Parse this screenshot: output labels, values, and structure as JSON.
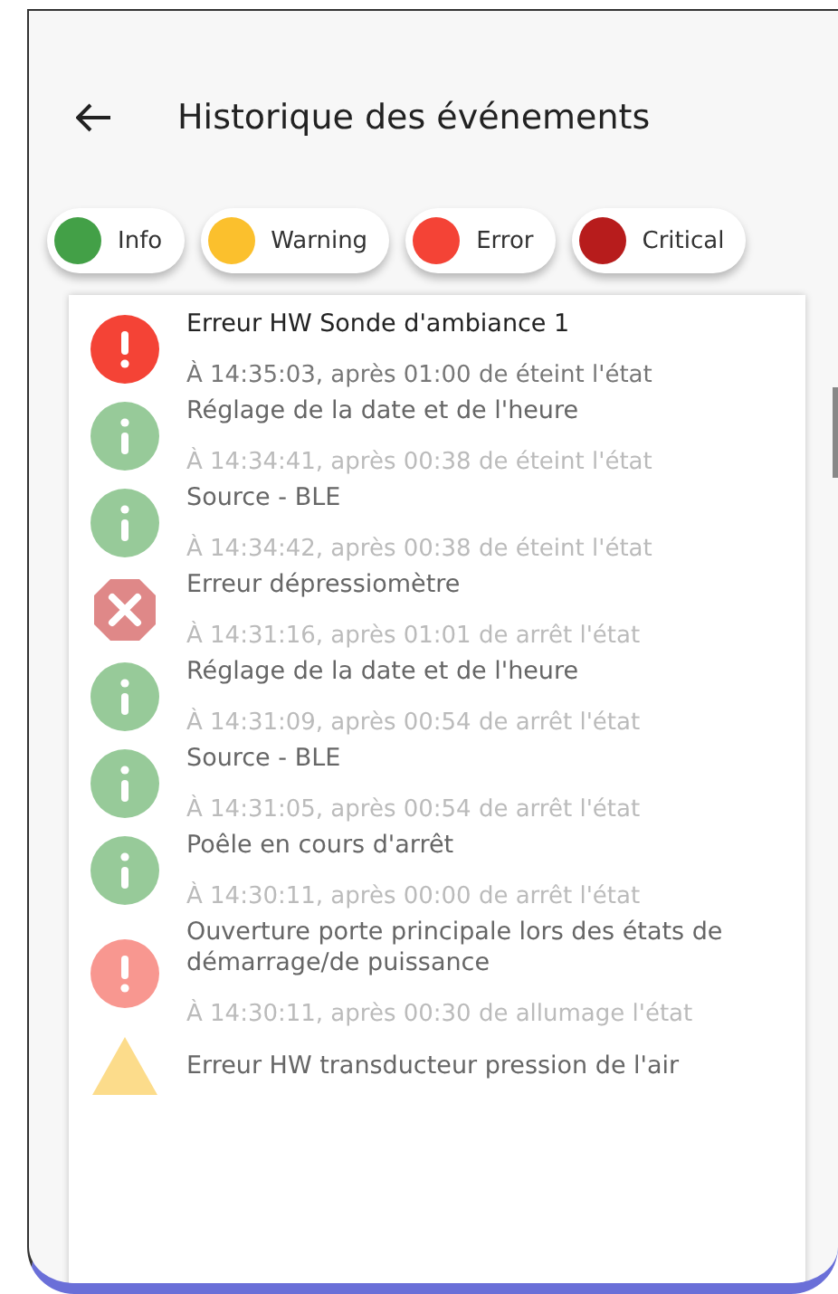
{
  "header": {
    "title": "Historique des événements"
  },
  "filters": [
    {
      "label": "Info",
      "color": "#43a047"
    },
    {
      "label": "Warning",
      "color": "#fbc02d"
    },
    {
      "label": "Error",
      "color": "#f44336"
    },
    {
      "label": "Critical",
      "color": "#b71c1c"
    }
  ],
  "events": [
    {
      "kind": "error",
      "unread": true,
      "title": "Erreur HW Sonde d'ambiance 1",
      "detail": "À 14:35:03, après 01:00 de éteint l'état"
    },
    {
      "kind": "info",
      "unread": false,
      "title": "Réglage de la date et de l'heure",
      "detail": "À 14:34:41, après 00:38 de éteint l'état"
    },
    {
      "kind": "info",
      "unread": false,
      "title": "Source - BLE",
      "detail": "À 14:34:42, après 00:38 de éteint l'état"
    },
    {
      "kind": "critical",
      "unread": false,
      "title": "Erreur dépressiomètre",
      "detail": "À 14:31:16, après 01:01 de arrêt l'état"
    },
    {
      "kind": "info",
      "unread": false,
      "title": "Réglage de la date et de l'heure",
      "detail": "À 14:31:09, après 00:54 de arrêt l'état"
    },
    {
      "kind": "info",
      "unread": false,
      "title": "Source - BLE",
      "detail": "À 14:31:05, après 00:54 de arrêt l'état"
    },
    {
      "kind": "info",
      "unread": false,
      "title": "Poêle en cours d'arrêt",
      "detail": "À 14:30:11, après 00:00 de arrêt l'état"
    },
    {
      "kind": "error",
      "unread": false,
      "title": "Ouverture porte principale lors des états de démarrage/de puissance",
      "detail": "À 14:30:11, après 00:30 de allumage l'état"
    },
    {
      "kind": "warning",
      "unread": false,
      "title": "Erreur HW transducteur pression de l'air"
    }
  ]
}
